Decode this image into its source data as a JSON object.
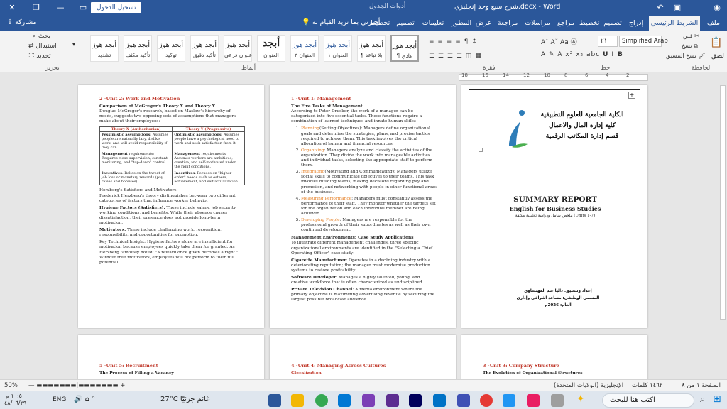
{
  "titlebar": {
    "doc_title": "شرح سبع وحد إنجليزي.docx - Word",
    "context_tools": "أدوات الجدول",
    "sign_in": "تسجيل الدخول"
  },
  "tabs": {
    "file": "ملف",
    "home": "الشريط الرئيسي",
    "insert": "إدراج",
    "design": "تصميم",
    "layout": "تخطيط",
    "references": "مراجع",
    "mailings": "مراسلات",
    "review": "مراجعة",
    "view": "عرض",
    "developer": "المطور",
    "help": "تعليمات",
    "table_design": "تصميم",
    "table_layout": "تخطيط",
    "tell_me": "أخبرني بما تريد القيام به",
    "share": "مشاركة"
  },
  "ribbon": {
    "font_name": "Simplified Arab",
    "font_size": "٢١",
    "paste": "لصق",
    "group_clipboard": "الحافظة",
    "group_font": "خط",
    "group_paragraph": "فقرة",
    "group_styles": "أنماط",
    "group_editing": "تحرير",
    "find": "بحث",
    "replace": "استبدال",
    "select": "تحديد",
    "cut": "قص",
    "copy": "نسخ",
    "format_painter": "نسخ التنسيق",
    "styles": [
      {
        "sample": "أبجد هوز",
        "name": "¶ عادي"
      },
      {
        "sample": "أبجد هوز",
        "name": "¶ بلا تباعد"
      },
      {
        "sample": "أبجد هوز",
        "name": "العنوان ١"
      },
      {
        "sample": "أبجد هوز",
        "name": "العنوان ٢"
      },
      {
        "sample": "أبجد",
        "name": "العنوان"
      },
      {
        "sample": "أبجد هوز",
        "name": "عنوان فرعي"
      },
      {
        "sample": "أبجد هوز",
        "name": "تأكيد دقيق"
      },
      {
        "sample": "أبجد هوز",
        "name": "توكيد"
      },
      {
        "sample": "أبجد هوز",
        "name": "تأكيد مكثف"
      },
      {
        "sample": "أبجد هوز",
        "name": "تشديد"
      }
    ],
    "ruler_ticks": [
      "18",
      "16",
      "14",
      "12",
      "10",
      "8",
      "6",
      "4",
      "2"
    ]
  },
  "pages": {
    "cover": {
      "university": [
        "الكلية الجامعية للعلوم التطبيقية",
        "كلية إدارة المال والاعمال",
        "قسم إدارة المكاتب الرقمية"
      ],
      "title": "SUMMARY REPORT",
      "subtitle": "English for Business Studies",
      "units": "ملخص شامل ودراسة تحليلية مكثفة (Units 1-7)",
      "prepared": "إعداد وتنسيق: داليا عبد المهنساوي",
      "job": "المسمى الوظيفي: مساعد اشرافي وإداري",
      "year": "العام: 2026م"
    },
    "unit1": {
      "heading": "1 -Unit 1: Management",
      "sub1": "The Five Tasks of Management",
      "intro": "According to Peter Drucker, the work of a manager can be categorized into five essential tasks. These functions require a combination of learned techniques and innate human skills:",
      "items": [
        {
          "label": "Planning",
          "text": "(Setting Objectives): Managers define organizational goals and determine the strategies, plans, and precise tactics required to achieve them. This task involves the critical allocation of human and financial resources."
        },
        {
          "label": "Organizing",
          "text": ": Managers analyze and classify the activities of the organization. They divide the work into manageable activities and individual tasks, selecting the appropriate staff to perform them."
        },
        {
          "label": "Integrating",
          "text": "(Motivating and Communicating): Managers utilize social skills to communicate objectives to their teams. This task involves building teams, making decisions regarding pay and promotion, and networking with people in other functional areas of the business."
        },
        {
          "label": "Measuring Performance",
          "text": ": Managers must constantly assess the performance of their staff. They monitor whether the targets set for the organization and each individual member are being achieved."
        },
        {
          "label": "Developing People",
          "text": ": Managers are responsible for the professional growth of their subordinates as well as their own continued development."
        }
      ],
      "sub2": "Management Environments: Case Study Applications",
      "env_intro": "To illustrate different management challenges, three specific organizational environments are identified in the \"Selecting a Chief Operating Officer\" case study:",
      "cases": [
        {
          "label": "Cigarette Manufacturer",
          "text": ": Operates in a declining industry with a deteriorating reputation; the manager must modernize production systems to restore profitability."
        },
        {
          "label": "Software Developer",
          "text": ": Manages a highly talented, young, and creative workforce that is often characterized as undisciplined."
        },
        {
          "label": "Private Television Channel",
          "text": ": A media environment where the primary objective is maximizing advertising revenue by securing the largest possible broadcast audience."
        }
      ]
    },
    "unit2": {
      "heading": "2 -Unit 2: Work and Motivation",
      "sub1": "Comparison of McGregor's Theory X and Theory Y",
      "intro": "Douglas McGregor's research, based on Maslow's hierarchy of needs, suggests two opposing sets of assumptions that managers make about their employees:",
      "table_headers": [
        "Theory X (Authoritarian)",
        "Theory Y (Progressive)"
      ],
      "table_rows": [
        {
          "x_label": "Pessimistic assumptions",
          "x_text": ": Assumes people are naturally lazy, dislike work, and will avoid responsibility if they can.",
          "y_label": "Optimistic assumptions",
          "y_text": ": Assumes people have a psychological need to work and seek satisfaction from it."
        },
        {
          "x_label": "Management",
          "x_text": " requirements: Requires close supervision, constant monitoring, and \"top-down\" control.",
          "y_label": "Management",
          "y_text": " requirements: Assumes workers are ambitious, creative, and self-motivated under the right conditions."
        },
        {
          "x_label": "Incentives",
          "x_text": ": Relies on the threat of job loss or monetary rewards (pay raises and bonuses).",
          "y_label": "Incentives",
          "y_text": ": Focuses on \"higher-order\" needs such as esteem, achievement, and self-actualization."
        }
      ],
      "sub2": "Herzberg's Satisfiers and Motivators",
      "herz_intro": "Frederick Herzberg's theory distinguishes between two different categories of factors that influence worker behavior:",
      "hygiene_label": "Hygiene Factors (Satisfiers):",
      "hygiene_text": " These include salary, job security, working conditions, and benefits. While their absence causes dissatisfaction, their presence does not provide long-term motivation.",
      "motivators_label": "Motivators:",
      "motivators_text": " These include challenging work, recognition, responsibility, and opportunities for promotion.",
      "insight": "Key Technical Insight: Hygiene factors alone are insufficient for motivation because employees quickly take them for granted. As Herzberg famously noted: \"A reward once given becomes a right.\" Without true motivators, employees will not perform to their full potential."
    },
    "row2": {
      "p3_heading": "3 -Unit 3: Company Structure",
      "p3_sub": "The Evolution of Organizational Structures",
      "p4_heading": "4 -Unit 4: Managing Across Cultures",
      "p4_sub": "Glocalization",
      "p5_heading": "5 -Unit 5: Recruitment",
      "p5_sub": "The Process of Filling a Vacancy"
    }
  },
  "statusbar": {
    "page": "الصفحة ١ من ٨",
    "words": "١٤٦٢ كلمات",
    "language": "الإنجليزية (الولايات المتحدة)",
    "zoom": "50%"
  },
  "taskbar": {
    "search_placeholder": "اكتب هنا للبحث",
    "weather": "27°C غائم جزئيًا",
    "lang": "ENG",
    "time": "١٠:٥٠ م",
    "date": "٤٨/٠٦/٢٩"
  }
}
